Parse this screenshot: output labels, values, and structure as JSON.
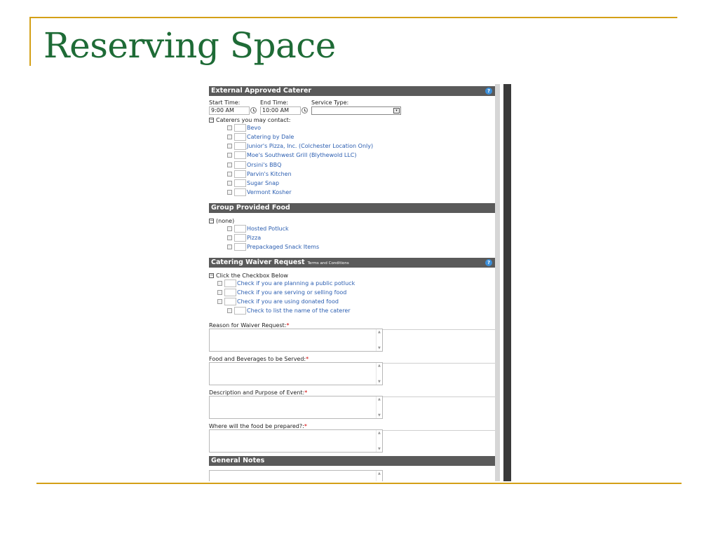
{
  "slide": {
    "title": "Reserving Space"
  },
  "external_caterer": {
    "header": "External Approved Caterer",
    "help": "?",
    "start_time_label": "Start Time:",
    "end_time_label": "End Time:",
    "service_type_label": "Service Type:",
    "start_time_value": "9:00 AM",
    "end_time_value": "10:00 AM",
    "service_type_value": "",
    "tree_label": "Caterers you may contact:",
    "items": [
      "Bevo",
      "Catering by Dale",
      "Junior's Pizza, Inc. (Colchester Location Only)",
      "Moe's Southwest Grill (Blythewold LLC)",
      "Orsini's BBQ",
      "Parvin's Kitchen",
      "Sugar Snap",
      "Vermont Kosher"
    ]
  },
  "group_food": {
    "header": "Group Provided Food",
    "tree_label": "(none)",
    "items": [
      "Hosted Potluck",
      "Pizza",
      "Prepackaged Snack Items"
    ]
  },
  "waiver": {
    "header": "Catering Waiver Request",
    "header_small": "Terms and Conditions",
    "help": "?",
    "tree_label": "Click the Checkbox Below",
    "items": [
      "Check if you are planning a public potluck",
      "Check if you are serving or selling food",
      "Check if you are using donated food",
      "Check to list the name of the caterer"
    ],
    "fields": [
      {
        "label": "Reason for Waiver Request:",
        "required": "*"
      },
      {
        "label": "Food and Beverages to be Served:",
        "required": "*"
      },
      {
        "label": "Description and Purpose of Event:",
        "required": "*"
      },
      {
        "label": "Where will the food be prepared?:",
        "required": "*"
      }
    ]
  },
  "general_notes": {
    "header": "General Notes"
  },
  "glyphs": {
    "collapse": "−",
    "dropdown": "▾",
    "scroll_up": "▲",
    "scroll_down": "▼"
  },
  "colors": {
    "title": "#1e6b36",
    "accent_line": "#d4a017",
    "header_bg": "#5a5a5a",
    "link": "#2a5db0",
    "required": "#d10000"
  }
}
